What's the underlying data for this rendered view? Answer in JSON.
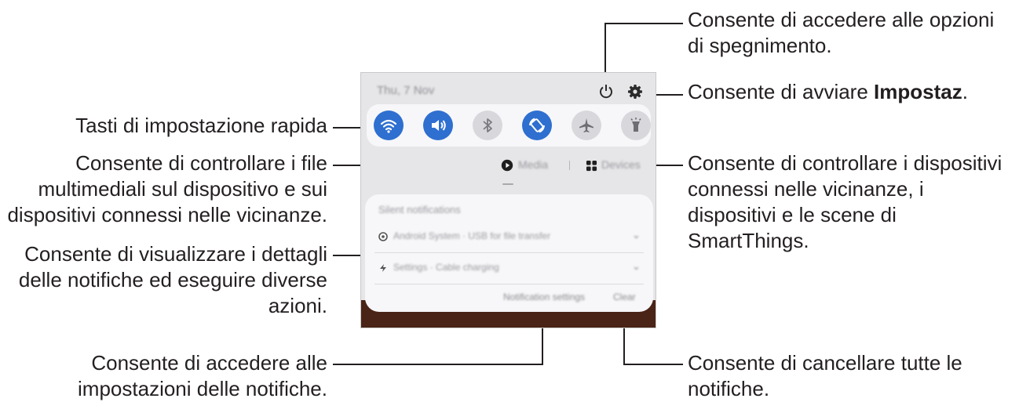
{
  "callouts": {
    "power_1": "Consente di accedere alle opzioni",
    "power_2": "di spegnimento.",
    "settings_prefix": "Consente di avviare ",
    "settings_bold": "Impostaz",
    "settings_suffix": ".",
    "quick_settings": "Tasti di impostazione rapida",
    "media_1": "Consente di controllare i file",
    "media_2": "multimediali sul dispositivo e sui",
    "media_3": "dispositivi connessi nelle vicinanze.",
    "devices_1": "Consente di controllare i dispositivi",
    "devices_2": "connessi nelle vicinanze, i",
    "devices_3": "dispositivi e le scene di",
    "devices_4": "SmartThings.",
    "notif_1": "Consente di visualizzare i dettagli",
    "notif_2": "delle notifiche ed eseguire diverse",
    "notif_3": "azioni.",
    "notif_settings_1": "Consente di accedere alle",
    "notif_settings_2": "impostazioni delle notifiche.",
    "clear_1": "Consente di cancellare tutte le",
    "clear_2": "notifiche."
  },
  "panel": {
    "date": "Thu, 7 Nov",
    "media_label": "Media",
    "devices_label": "Devices",
    "silent_header": "Silent notifications",
    "notif_1": "Android System · USB for file transfer",
    "notif_2": "Settings · Cable charging",
    "notification_settings": "Notification settings",
    "clear": "Clear"
  },
  "quick_buttons": [
    {
      "name": "wifi-icon",
      "state": "on"
    },
    {
      "name": "sound-icon",
      "state": "on"
    },
    {
      "name": "bluetooth-icon",
      "state": "off"
    },
    {
      "name": "auto-rotate-icon",
      "state": "on"
    },
    {
      "name": "airplane-icon",
      "state": "off"
    },
    {
      "name": "flashlight-icon",
      "state": "off"
    }
  ],
  "colors": {
    "accent": "#2e6fd0",
    "text": "#231f20",
    "panel": "#e6e6e8"
  }
}
